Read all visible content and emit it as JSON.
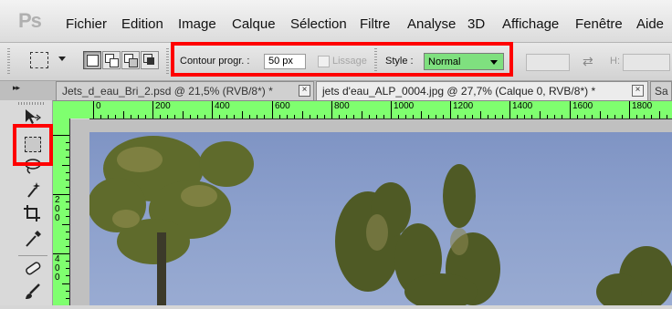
{
  "app": {
    "logo": "Ps"
  },
  "menu": [
    "Fichier",
    "Edition",
    "Image",
    "Calque",
    "Sélection",
    "Filtre",
    "Analyse",
    "3D",
    "Affichage",
    "Fenêtre",
    "Aide"
  ],
  "options": {
    "feather_label": "Contour progr. :",
    "feather_value": "50 px",
    "antialias_label": "Lissage",
    "style_label": "Style :",
    "style_value": "Normal",
    "height_label": "H:",
    "style_highlight_color": "#7fe07f"
  },
  "tabs": [
    {
      "label": "Jets_d_eau_Bri_2.psd @ 21,5% (RVB/8*) *",
      "active": false
    },
    {
      "label": "jets d'eau_ALP_0004.jpg @ 27,7% (Calque 0, RVB/8*) *",
      "active": true
    },
    {
      "label": "Sa",
      "active": false
    }
  ],
  "tools": [
    "move-tool",
    "rectangular-marquee-tool",
    "lasso-tool",
    "magic-wand-tool",
    "crop-tool",
    "eyedropper-tool",
    "healing-brush-tool",
    "brush-tool"
  ],
  "ruler": {
    "top_labels": [
      "0",
      "200",
      "400",
      "600",
      "800",
      "1000",
      "1200",
      "1400",
      "1600",
      "1800"
    ],
    "left_labels": [
      "200",
      "400"
    ],
    "color": "#7fff6f"
  },
  "highlight_color": "#ff0000"
}
